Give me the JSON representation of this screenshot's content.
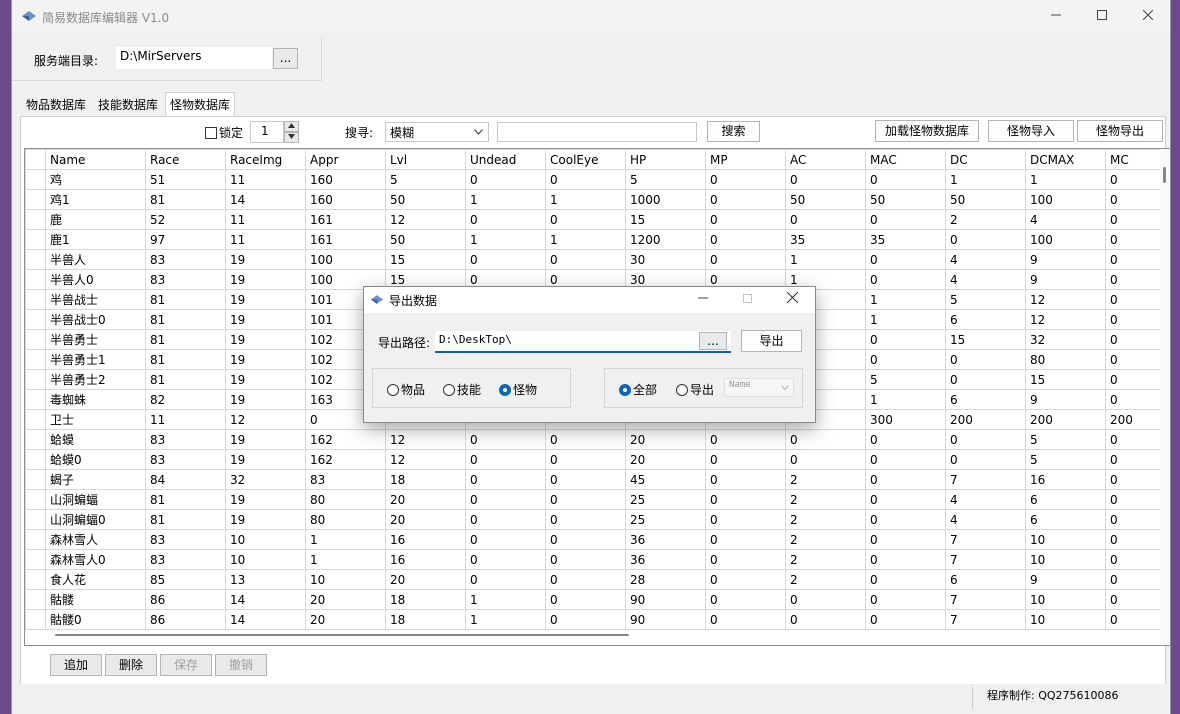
{
  "window": {
    "title": "简易数据库编辑器 V1.0",
    "min_icon": "minimize-icon",
    "max_icon": "maximize-icon",
    "close_icon": "close-icon"
  },
  "server": {
    "label": "服务端目录:",
    "path": "D:\\MirServers",
    "browse": "..."
  },
  "tabs": [
    {
      "label": "物品数据库"
    },
    {
      "label": "技能数据库"
    },
    {
      "label": "怪物数据库"
    }
  ],
  "toolbar": {
    "lock_label": "锁定",
    "lock_value": "1",
    "search_label": "搜寻:",
    "search_mode": "模糊",
    "search_text": "",
    "search_button": "搜索",
    "load_button": "加载怪物数据库",
    "import_button": "怪物导入",
    "export_button": "怪物导出"
  },
  "grid": {
    "columns": [
      "Name",
      "Race",
      "RaceImg",
      "Appr",
      "Lvl",
      "Undead",
      "CoolEye",
      "HP",
      "MP",
      "AC",
      "MAC",
      "DC",
      "DCMAX",
      "MC"
    ],
    "rows": [
      [
        "鸡",
        "51",
        "11",
        "160",
        "5",
        "0",
        "0",
        "5",
        "0",
        "0",
        "0",
        "1",
        "1",
        "0"
      ],
      [
        "鸡1",
        "81",
        "14",
        "160",
        "50",
        "1",
        "1",
        "1000",
        "0",
        "50",
        "50",
        "50",
        "100",
        "0"
      ],
      [
        "鹿",
        "52",
        "11",
        "161",
        "12",
        "0",
        "0",
        "15",
        "0",
        "0",
        "0",
        "2",
        "4",
        "0"
      ],
      [
        "鹿1",
        "97",
        "11",
        "161",
        "50",
        "1",
        "1",
        "1200",
        "0",
        "35",
        "35",
        "0",
        "100",
        "0"
      ],
      [
        "半兽人",
        "83",
        "19",
        "100",
        "15",
        "0",
        "0",
        "30",
        "0",
        "1",
        "0",
        "4",
        "9",
        "0"
      ],
      [
        "半兽人0",
        "83",
        "19",
        "100",
        "15",
        "0",
        "0",
        "30",
        "0",
        "1",
        "0",
        "4",
        "9",
        "0"
      ],
      [
        "半兽战士",
        "81",
        "19",
        "101",
        "",
        "",
        "",
        "",
        "",
        "",
        "1",
        "5",
        "12",
        "0"
      ],
      [
        "半兽战士0",
        "81",
        "19",
        "101",
        "",
        "",
        "",
        "",
        "",
        "",
        "1",
        "6",
        "12",
        "0"
      ],
      [
        "半兽勇士",
        "81",
        "19",
        "102",
        "",
        "",
        "",
        "",
        "",
        "",
        "0",
        "15",
        "32",
        "0"
      ],
      [
        "半兽勇士1",
        "81",
        "19",
        "102",
        "",
        "",
        "",
        "",
        "",
        "",
        "0",
        "0",
        "80",
        "0"
      ],
      [
        "半兽勇士2",
        "81",
        "19",
        "102",
        "",
        "",
        "",
        "",
        "",
        "",
        "5",
        "0",
        "15",
        "0"
      ],
      [
        "毒蜘蛛",
        "82",
        "19",
        "163",
        "",
        "",
        "",
        "",
        "",
        "",
        "1",
        "6",
        "9",
        "0"
      ],
      [
        "卫士",
        "11",
        "12",
        "0",
        "",
        "",
        "",
        "",
        "",
        "",
        "300",
        "200",
        "200",
        "200"
      ],
      [
        "蛤蟆",
        "83",
        "19",
        "162",
        "12",
        "0",
        "0",
        "20",
        "0",
        "0",
        "0",
        "0",
        "5",
        "0"
      ],
      [
        "蛤蟆0",
        "83",
        "19",
        "162",
        "12",
        "0",
        "0",
        "20",
        "0",
        "0",
        "0",
        "0",
        "5",
        "0"
      ],
      [
        "蝎子",
        "84",
        "32",
        "83",
        "18",
        "0",
        "0",
        "45",
        "0",
        "2",
        "0",
        "7",
        "16",
        "0"
      ],
      [
        "山洞蝙蝠",
        "81",
        "19",
        "80",
        "20",
        "0",
        "0",
        "25",
        "0",
        "2",
        "0",
        "4",
        "6",
        "0"
      ],
      [
        "山洞蝙蝠0",
        "81",
        "19",
        "80",
        "20",
        "0",
        "0",
        "25",
        "0",
        "2",
        "0",
        "4",
        "6",
        "0"
      ],
      [
        "森林雪人",
        "83",
        "10",
        "1",
        "16",
        "0",
        "0",
        "36",
        "0",
        "2",
        "0",
        "7",
        "10",
        "0"
      ],
      [
        "森林雪人0",
        "83",
        "10",
        "1",
        "16",
        "0",
        "0",
        "36",
        "0",
        "2",
        "0",
        "7",
        "10",
        "0"
      ],
      [
        "食人花",
        "85",
        "13",
        "10",
        "20",
        "0",
        "0",
        "28",
        "0",
        "2",
        "0",
        "6",
        "9",
        "0"
      ],
      [
        "骷髅",
        "86",
        "14",
        "20",
        "18",
        "1",
        "0",
        "90",
        "0",
        "0",
        "0",
        "7",
        "10",
        "0"
      ],
      [
        "骷髅0",
        "86",
        "14",
        "20",
        "18",
        "1",
        "0",
        "90",
        "0",
        "0",
        "0",
        "7",
        "10",
        "0"
      ]
    ]
  },
  "bottom": {
    "add": "追加",
    "delete": "删除",
    "save": "保存",
    "undo": "撤销"
  },
  "status": {
    "author": "程序制作: QQ275610086"
  },
  "dialog": {
    "title": "导出数据",
    "path_label": "导出路径:",
    "path_value": "D:\\DeskTop\\",
    "browse": "...",
    "export_button": "导出",
    "type_options": [
      "物品",
      "技能",
      "怪物"
    ],
    "type_selected": "怪物",
    "scope_all": "全部",
    "scope_export": "导出",
    "scope_selected": "全部",
    "field_select": "Name"
  }
}
